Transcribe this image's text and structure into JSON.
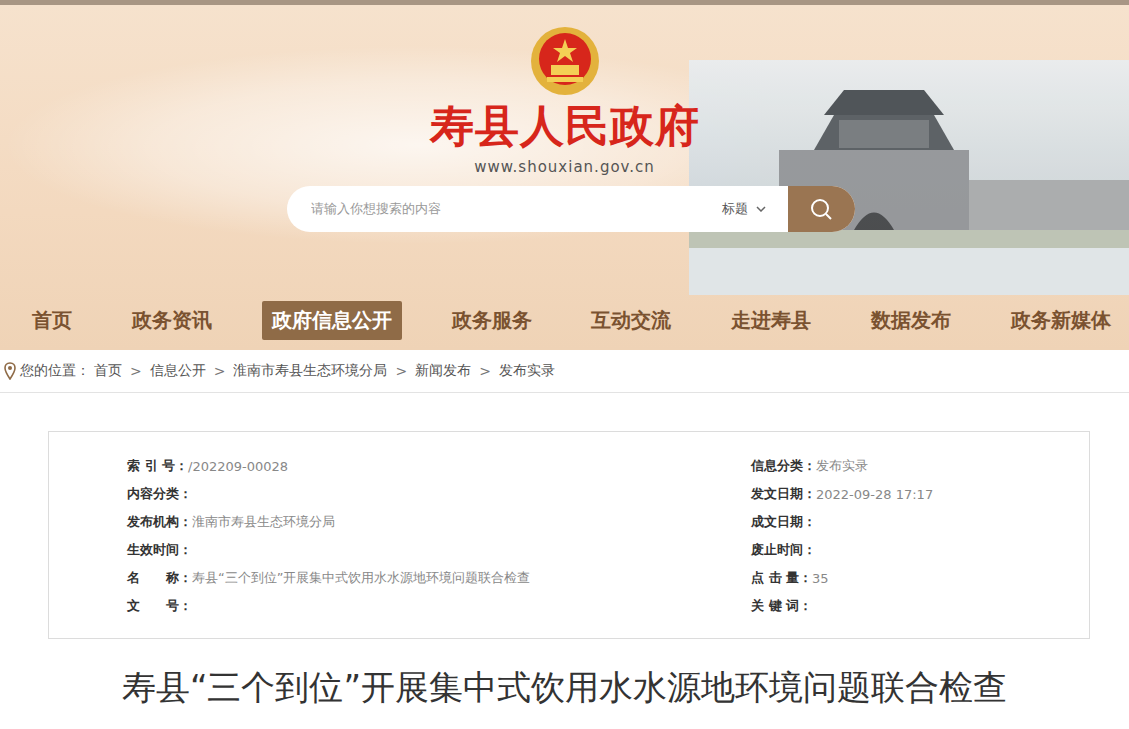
{
  "header": {
    "title": "寿县人民政府",
    "url": "www.shouxian.gov.cn",
    "search": {
      "placeholder": "请输入你想搜索的内容",
      "scope": "标题"
    }
  },
  "nav": [
    {
      "label": "首页",
      "selected": false
    },
    {
      "label": "政务资讯",
      "selected": false
    },
    {
      "label": "政府信息公开",
      "selected": true
    },
    {
      "label": "政务服务",
      "selected": false
    },
    {
      "label": "互动交流",
      "selected": false
    },
    {
      "label": "走进寿县",
      "selected": false
    },
    {
      "label": "数据发布",
      "selected": false
    },
    {
      "label": "政务新媒体",
      "selected": false
    }
  ],
  "breadcrumb": {
    "prefix": "您的位置：",
    "separator": ">",
    "items": [
      "首页",
      "信息公开",
      "淮南市寿县生态环境分局",
      "新闻发布",
      "发布实录"
    ]
  },
  "meta": [
    {
      "left": {
        "label": "索 引 号：",
        "value": "/202209-00028"
      },
      "right": {
        "label": "信息分类：",
        "value": "发布实录"
      }
    },
    {
      "left": {
        "label": "内容分类：",
        "value": ""
      },
      "right": {
        "label": "发文日期：",
        "value": "2022-09-28 17:17"
      }
    },
    {
      "left": {
        "label": "发布机构：",
        "value": "淮南市寿县生态环境分局"
      },
      "right": {
        "label": "成文日期：",
        "value": ""
      }
    },
    {
      "left": {
        "label": "生效时间：",
        "value": ""
      },
      "right": {
        "label": "废止时间：",
        "value": ""
      }
    },
    {
      "left": {
        "label": "名　　称：",
        "value": "寿县“三个到位”开展集中式饮用水水源地环境问题联合检查"
      },
      "right": {
        "label": "点 击 量：",
        "value": "35"
      }
    },
    {
      "left": {
        "label": "文　　号：",
        "value": ""
      },
      "right": {
        "label": "关 键 词：",
        "value": ""
      }
    }
  ],
  "article": {
    "title": "寿县“三个到位”开展集中式饮用水水源地环境问题联合检查"
  }
}
